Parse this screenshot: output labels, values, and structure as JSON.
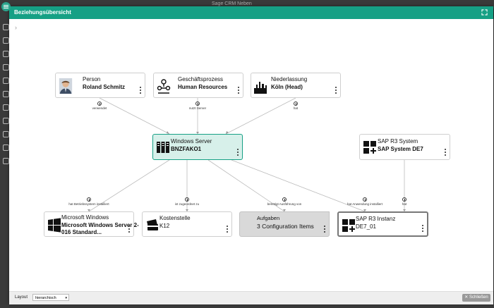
{
  "app": {
    "search_text": "Sage CRM Neben"
  },
  "dialog": {
    "title": "Beziehungsübersicht",
    "close_label": "Schließen"
  },
  "nodes": {
    "person": {
      "type": "Person",
      "name": "Roland Schmitz"
    },
    "process": {
      "type": "Geschäftsprozess",
      "name": "Human Resources"
    },
    "branch": {
      "type": "Niederlassung",
      "name": "Köln (Head)"
    },
    "server": {
      "type": "Windows Server",
      "name": "BNZFAKO1"
    },
    "sap_system": {
      "type": "SAP R3 System",
      "name": "SAP System DE7"
    },
    "os": {
      "type": "Microsoft Windows",
      "name_line1": "Microsoft Windows Server 2-",
      "name_line2": "016 Standard..."
    },
    "cost_center": {
      "type": "Kostenstelle",
      "name": "K12"
    },
    "tasks": {
      "type": "Aufgaben",
      "name": "3 Configuration Items"
    },
    "sap_instance": {
      "type": "SAP R3 Instanz",
      "name": "DE7_01"
    }
  },
  "edges": {
    "person_server": "verwendet",
    "process_server": "nutzt Server",
    "branch_server": "hat",
    "server_os": "hat Betriebssystem installiert",
    "server_cost": "ist zugeordnet zu",
    "server_tasks": "benötigt Ausführung von",
    "server_sapinst": "hat Anwendung installiert",
    "sapsys_sapinst": "hat"
  },
  "footer": {
    "layout_label": "Layout",
    "layout_value": "hierarchisch"
  },
  "colors": {
    "accent": "#16a085",
    "selected_bg": "#d7f0ea"
  }
}
